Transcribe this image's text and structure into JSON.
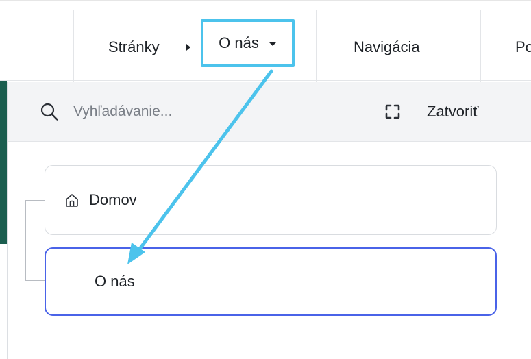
{
  "toolbar": {
    "breadcrumb_root": "Stránky",
    "current_page": "O nás",
    "nav_item": "Navigácia",
    "next_item_partial": "Po"
  },
  "panel": {
    "search_placeholder": "Vyhľadávanie...",
    "close_label": "Zatvoriť"
  },
  "tree": {
    "items": [
      {
        "label": "Domov",
        "icon": "home-icon"
      },
      {
        "label": "O nás",
        "selected": true
      }
    ]
  },
  "colors": {
    "highlight_box": "#4cc3ec",
    "annotation_arrow": "#4cc3ec",
    "selected_border": "#4a63e8",
    "header_bg": "#f3f4f6"
  }
}
